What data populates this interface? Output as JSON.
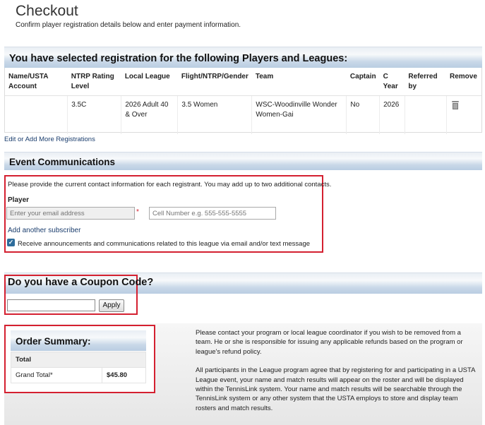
{
  "page": {
    "title": "Checkout",
    "subtitle": "Confirm player registration details below and enter payment information."
  },
  "registrations": {
    "header": "You have selected registration for the following Players and Leagues:",
    "columns": [
      "Name/USTA Account",
      "NTRP Rating Level",
      "Local League",
      "Flight/NTRP/Gender",
      "Team",
      "Captain",
      "C Year",
      "Referred by",
      "Remove"
    ],
    "rows": [
      {
        "name": "",
        "ntrp": "3.5C",
        "league": "2026 Adult 40 & Over",
        "flight": "3.5 Women",
        "team": "WSC-Woodinville Wonder Women-Gai",
        "captain": "No",
        "year": "2026",
        "referred": "",
        "remove_icon": "trash-icon"
      }
    ],
    "edit_link": "Edit or Add More Registrations"
  },
  "communications": {
    "header": "Event Communications",
    "instructions": "Please provide the current contact information for each registrant. You may add up to two additional contacts.",
    "player_label": "Player",
    "email_placeholder": "Enter your email address",
    "required_mark": "*",
    "cell_placeholder": "Cell Number e.g. 555-555-5555",
    "add_subscriber": "Add another subscriber",
    "opt_in_checked": true,
    "opt_in_label": "Receive announcements and communications related to this league via email and/or text message"
  },
  "coupon": {
    "title": "Do you have a Coupon Code?",
    "value": "",
    "apply_label": "Apply"
  },
  "order_summary": {
    "title": "Order Summary:",
    "total_label": "Total",
    "grand_total_label": "Grand Total*",
    "grand_total_value": "$45.80"
  },
  "notice": {
    "paragraph1": "Please contact your program or local league coordinator if you wish to be removed from a team. He or she is responsible for issuing any applicable refunds based on the program or league's refund policy.",
    "paragraph2": "All participants in the League program agree that by registering for and participating in a USTA League event, your name and match results will appear on the roster and will be displayed within the TennisLink system. Your name and match results will be searchable through the TennisLink system or any other system that the USTA employs to store and display team rosters and match results."
  },
  "colors": {
    "highlight_border": "#d42030",
    "header_gradient": "#b9cde2",
    "link": "#1a3d6d",
    "checkbox": "#2d6c9b"
  }
}
